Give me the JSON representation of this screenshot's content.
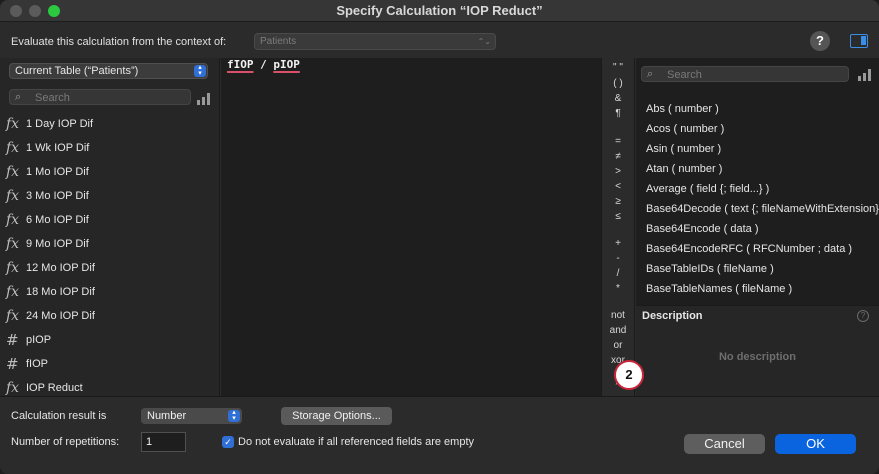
{
  "window": {
    "title": "Specify Calculation “IOP Reduct”"
  },
  "context": {
    "label": "Evaluate this calculation from the context of:",
    "value": "Patients",
    "help": "?"
  },
  "left_panel": {
    "table_select": "Current Table (“Patients”)",
    "search_placeholder": "Search",
    "fields": [
      {
        "icon": "fx",
        "name": "1 Day IOP Dif"
      },
      {
        "icon": "fx",
        "name": "1 Wk IOP Dif"
      },
      {
        "icon": "fx",
        "name": "1 Mo IOP Dif"
      },
      {
        "icon": "fx",
        "name": "3 Mo IOP Dif"
      },
      {
        "icon": "fx",
        "name": "6 Mo IOP Dif"
      },
      {
        "icon": "fx",
        "name": "9 Mo IOP Dif"
      },
      {
        "icon": "fx",
        "name": "12 Mo IOP Dif"
      },
      {
        "icon": "fx",
        "name": "18 Mo IOP Dif"
      },
      {
        "icon": "fx",
        "name": "24 Mo IOP Dif"
      },
      {
        "icon": "#",
        "name": "pIOP"
      },
      {
        "icon": "#",
        "name": "fIOP"
      },
      {
        "icon": "fx",
        "name": "IOP Reduct"
      }
    ]
  },
  "editor": {
    "token1": "fIOP",
    "operator": " / ",
    "token2": "pIOP"
  },
  "operators": [
    "\" \"",
    "( )",
    "&",
    "¶",
    "=",
    "≠",
    ">",
    "<",
    "≥",
    "≤",
    "+",
    "-",
    "/",
    "*",
    "not",
    "and",
    "or",
    "xor",
    "^"
  ],
  "functions": {
    "search_placeholder": "Search",
    "items": [
      "Abs ( number )",
      "Acos ( number )",
      "Asin ( number )",
      "Atan ( number )",
      "Average ( field {; field...} )",
      "Base64Decode ( text {; fileNameWithExtension} )",
      "Base64Encode ( data )",
      "Base64EncodeRFC ( RFCNumber ; data )",
      "BaseTableIDs ( fileName )",
      "BaseTableNames ( fileName )"
    ]
  },
  "description": {
    "title": "Description",
    "body": "No description",
    "help": "?"
  },
  "bottom": {
    "result_label": "Calculation result is",
    "result_value": "Number",
    "storage_button": "Storage Options...",
    "repetitions_label": "Number of repetitions:",
    "repetitions_value": "1",
    "checkbox_label": "Do not evaluate if all referenced fields are empty",
    "cancel": "Cancel",
    "ok": "OK"
  },
  "badge": "2",
  "colors": {
    "accent": "#2f6fd6",
    "ok_button": "#0a64e0",
    "underline": "#d9506a",
    "badge_ring": "#c8243a"
  }
}
